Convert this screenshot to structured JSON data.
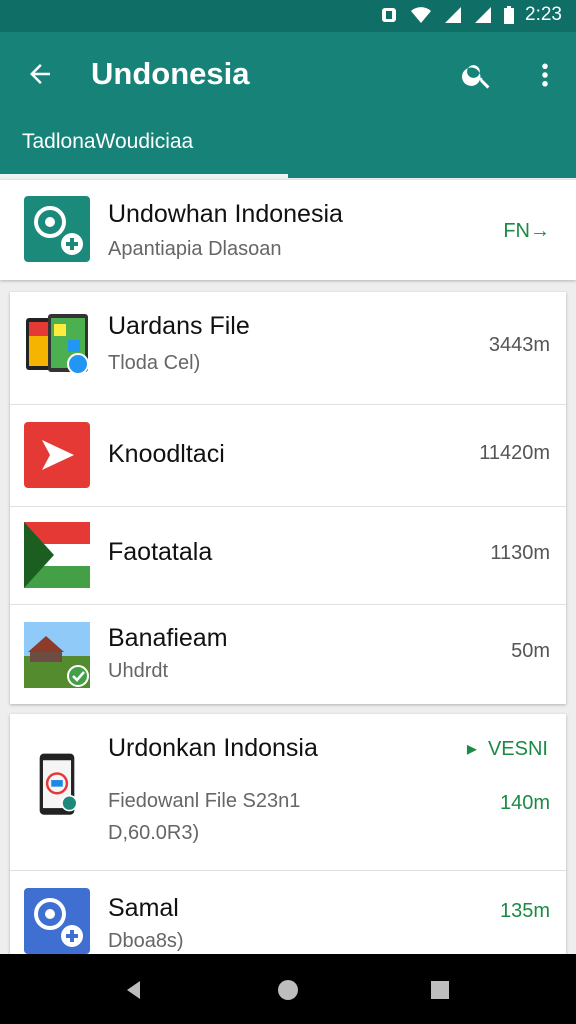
{
  "status_bar": {
    "time": "2:23"
  },
  "app_bar": {
    "title": "Undonesia",
    "tab_label": "TadlonaWoudiciaa"
  },
  "header_item": {
    "title": "Undowhan Indonesia",
    "subtitle": "Apantiapia Dlasoan",
    "action": "FN→"
  },
  "list1": [
    {
      "title": "Uardans File",
      "subtitle": "Tloda Cel)",
      "size": "3443m"
    },
    {
      "title": "Knoodltaci",
      "subtitle": "",
      "size": "11420m"
    },
    {
      "title": "Faotatala",
      "subtitle": "",
      "size": "1130m"
    },
    {
      "title": "Banafieam",
      "subtitle": "Uhdrdt",
      "size": "50m"
    }
  ],
  "list2": [
    {
      "title": "Urdonkan Indonsia",
      "action": "VESNI",
      "subtitle": "Fiedowanl File S23n1",
      "subtitle2": "D,60.0R3)",
      "size": "140m"
    },
    {
      "title": "Samal",
      "subtitle": "Dboa8s)",
      "size": "135m"
    }
  ],
  "colors": {
    "status_bar": "#0f6e66",
    "app_bar": "#178378",
    "accent_green": "#1b8a45"
  },
  "icons": [
    "back-arrow-icon",
    "search-icon",
    "more-vert-icon",
    "wifi-icon",
    "signal-icon",
    "battery-icon",
    "alarm-icon"
  ]
}
